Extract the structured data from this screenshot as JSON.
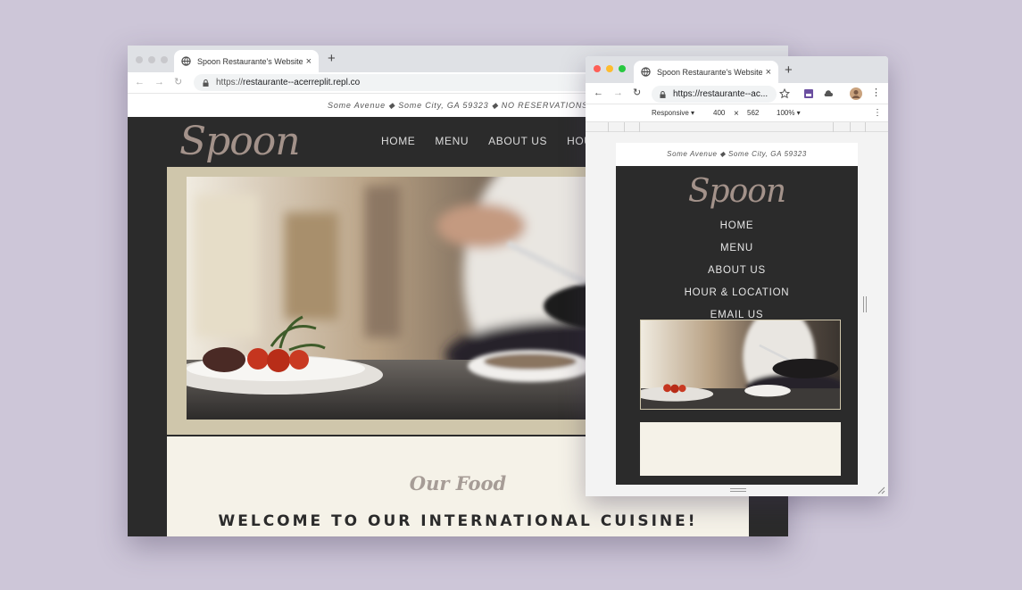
{
  "main_window": {
    "tab_title": "Spoon Restaurante's Website:",
    "url_scheme": "https://",
    "url_host": "restaurante--acerreplit.repl.co"
  },
  "site": {
    "address_line": "Some Avenue ◆ Some City, GA 59323 ◆ NO RESERVATIONS",
    "logo": "Spoon",
    "nav": [
      "HOME",
      "MENU",
      "ABOUT US",
      "HOUR"
    ],
    "section_script": "Our Food",
    "section_heading": "WELCOME TO OUR INTERNATIONAL CUISINE!"
  },
  "responsive_window": {
    "tab_title": "Spoon Restaurante's Website:",
    "url": "https://restaurante--ac...",
    "device_mode": "Responsive ▾",
    "width": "400",
    "times": "×",
    "height": "562",
    "zoom": "100% ▾",
    "site_address": "Some Avenue ◆ Some City, GA 59323",
    "site_logo": "Spoon",
    "site_nav": [
      "HOME",
      "MENU",
      "ABOUT US",
      "HOUR & LOCATION",
      "EMAIL US"
    ]
  },
  "icons": {
    "back": "←",
    "forward": "→",
    "reload": "↻",
    "new_tab": "+",
    "close_tab": "×",
    "more": "⋮"
  }
}
